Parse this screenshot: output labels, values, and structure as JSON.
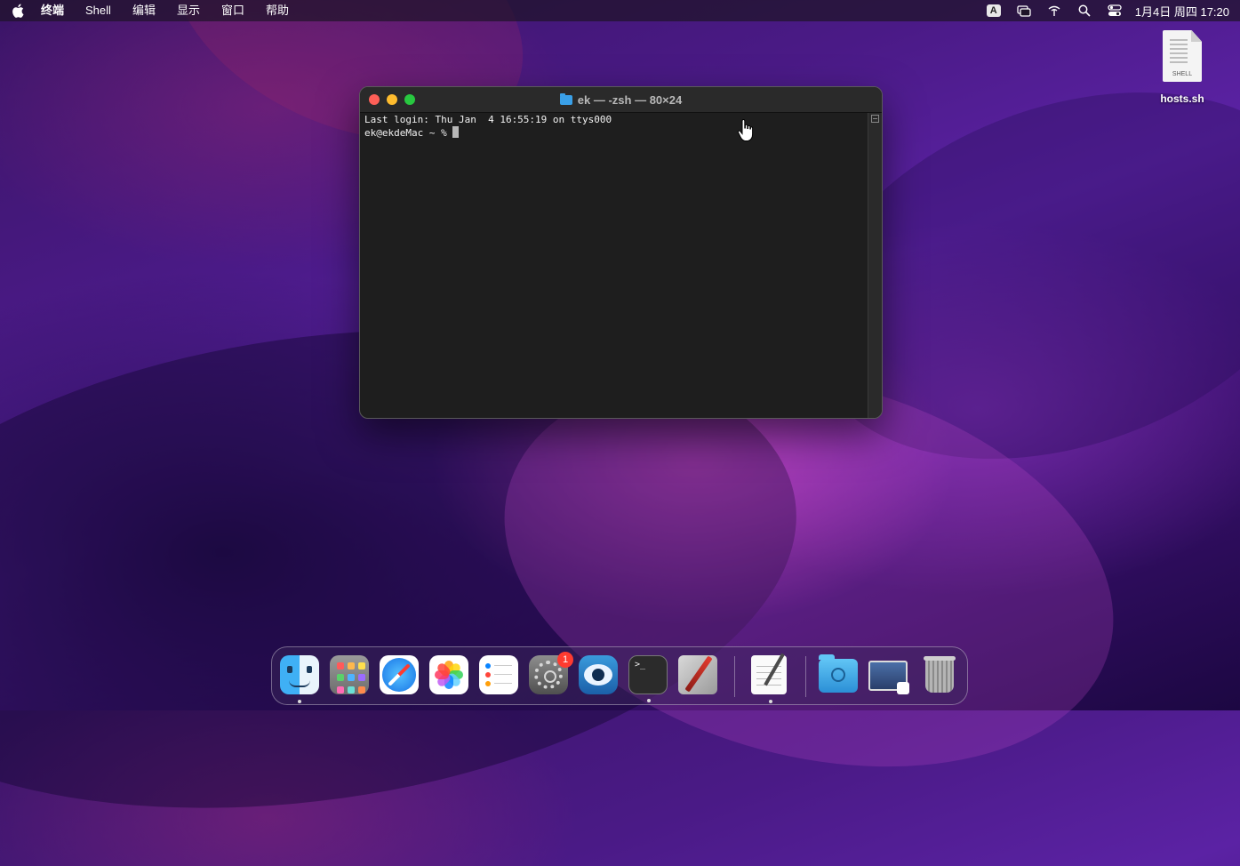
{
  "menubar": {
    "apple_icon": "apple-logo-icon",
    "app_name": "终端",
    "menus": [
      "Shell",
      "编辑",
      "显示",
      "窗口",
      "帮助"
    ],
    "input_method": "A",
    "tray_icons": [
      "input-method-icon",
      "screen-mirroring-icon",
      "wifi-icon",
      "spotlight-search-icon",
      "control-center-icon"
    ],
    "clock": "1月4日 周四  17:20"
  },
  "desktop": {
    "file_name": "hosts.sh",
    "file_type_label": "SHELL"
  },
  "terminal": {
    "title": "ek — -zsh — 80×24",
    "lines": [
      "Last login: Thu Jan  4 16:55:19 on ttys000",
      "ek@ekdeMac ~ % "
    ]
  },
  "dock": {
    "items": [
      {
        "name": "Finder",
        "icon": "finder-icon",
        "running": true
      },
      {
        "name": "Launchpad",
        "icon": "launchpad-icon",
        "running": false
      },
      {
        "name": "Safari",
        "icon": "safari-icon",
        "running": false
      },
      {
        "name": "Photos",
        "icon": "photos-icon",
        "running": false
      },
      {
        "name": "Reminders",
        "icon": "reminders-icon",
        "running": false
      },
      {
        "name": "System Preferences",
        "icon": "system-preferences-icon",
        "running": false,
        "badge": "1"
      },
      {
        "name": "Proxyman",
        "icon": "proxyman-icon",
        "running": false
      },
      {
        "name": "Terminal",
        "icon": "terminal-icon",
        "running": true,
        "glyph": ">_"
      },
      {
        "name": "TextEdit",
        "icon": "textedit-icon",
        "running": false
      },
      {
        "name": "Notes",
        "icon": "notes-icon",
        "running": true
      },
      {
        "name": "Downloads",
        "icon": "downloads-folder-icon",
        "running": false
      },
      {
        "name": "Preview",
        "icon": "preview-icon",
        "running": false
      },
      {
        "name": "Trash",
        "icon": "trash-icon",
        "running": false
      }
    ]
  },
  "colors": {
    "terminal_bg": "#1e1e1e",
    "close": "#fe5f57",
    "minimize": "#febc2e",
    "maximize": "#28c840",
    "badge": "#ff3b30"
  }
}
